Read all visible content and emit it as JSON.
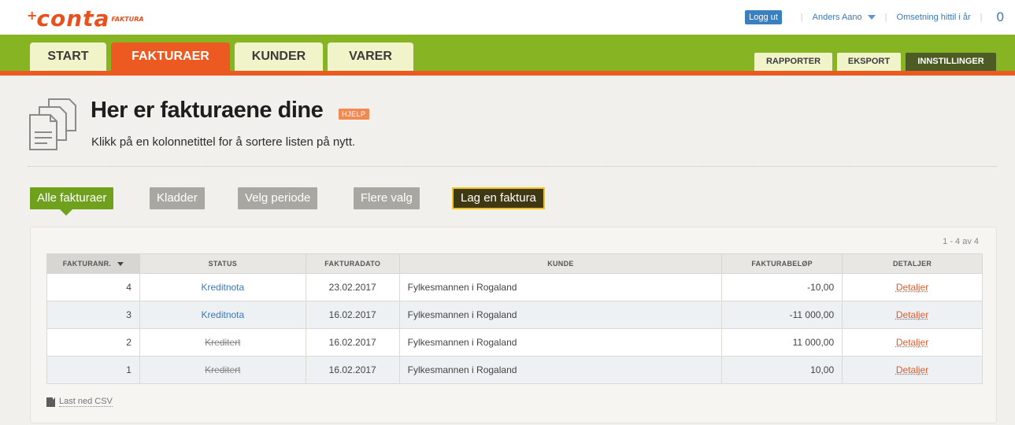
{
  "header": {
    "logo_text": "conta",
    "logo_plus": "+",
    "logo_sub": "FAKTURA",
    "logout_label": "Logg ut",
    "user_name": "Anders Aano",
    "revenue_label": "Omsetning hittil i år",
    "revenue_value": "0"
  },
  "nav": {
    "tabs": [
      "START",
      "FAKTURAER",
      "KUNDER",
      "VARER"
    ],
    "right_tabs": [
      "RAPPORTER",
      "EKSPORT",
      "INNSTILLINGER"
    ]
  },
  "page": {
    "title": "Her er fakturaene dine",
    "help_badge": "HJELP",
    "subtitle": "Klikk på en kolonnetittel for å sortere listen på nytt."
  },
  "filters": {
    "all": "Alle fakturaer",
    "drafts": "Kladder",
    "period": "Velg periode",
    "more": "Flere valg",
    "create": "Lag en faktura"
  },
  "list": {
    "paging": "1 - 4 av 4",
    "columns": [
      "FAKTURANR.",
      "STATUS",
      "FAKTURADATO",
      "KUNDE",
      "FAKTURABELØP",
      "DETALJER"
    ],
    "rows": [
      {
        "nr": "4",
        "status": "Kreditnota",
        "date": "23.02.2017",
        "customer": "Fylkesmannen i Rogaland",
        "amount": "-10,00",
        "details": "Detaljer"
      },
      {
        "nr": "3",
        "status": "Kreditnota",
        "date": "16.02.2017",
        "customer": "Fylkesmannen i Rogaland",
        "amount": "-11 000,00",
        "details": "Detaljer"
      },
      {
        "nr": "2",
        "status": "Kreditert",
        "date": "16.02.2017",
        "customer": "Fylkesmannen i Rogaland",
        "amount": "11 000,00",
        "details": "Detaljer"
      },
      {
        "nr": "1",
        "status": "Kreditert",
        "date": "16.02.2017",
        "customer": "Fylkesmannen i Rogaland",
        "amount": "10,00",
        "details": "Detaljer"
      }
    ],
    "csv_label": "Last ned CSV"
  },
  "colors": {
    "brand_orange": "#ec5a22",
    "nav_green": "#86b423",
    "active_filter": "#6fa11c",
    "link_blue": "#3a78b8"
  }
}
